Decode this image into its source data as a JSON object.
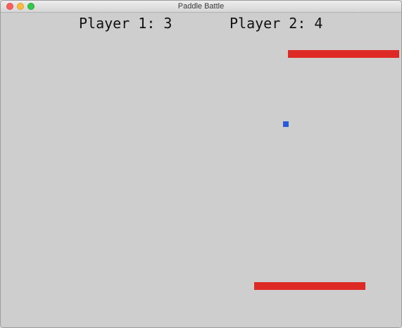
{
  "window": {
    "title": "Paddle Battle"
  },
  "scoreboard": {
    "player1": "Player 1: 3",
    "player2": "Player 2: 4"
  },
  "colors": {
    "paddle": "#dd2a25",
    "ball": "#2a5bd7",
    "background": "#cecece"
  }
}
